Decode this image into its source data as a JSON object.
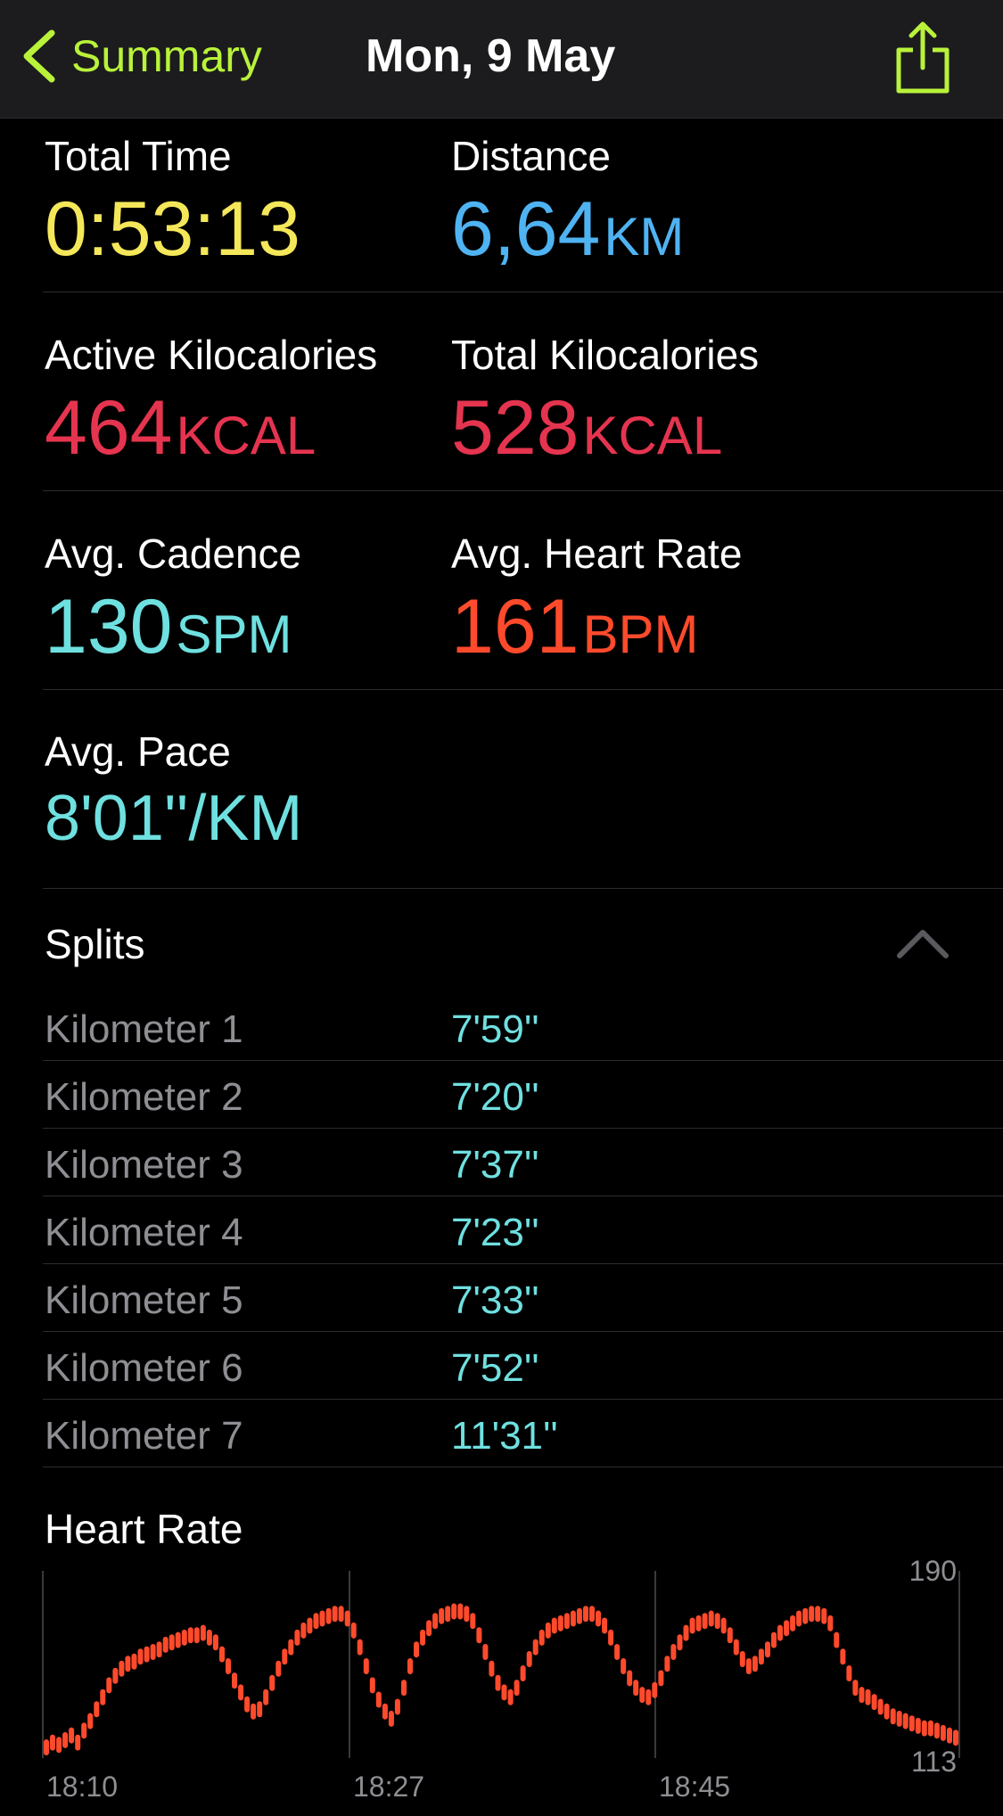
{
  "nav": {
    "back_label": "Summary",
    "title": "Mon, 9 May",
    "accent_color": "#b9f23a",
    "back_icon": "chevron-left-icon",
    "share_icon": "share-icon"
  },
  "stats": {
    "total_time": {
      "label": "Total Time",
      "value": "0:53:13",
      "unit": ""
    },
    "distance": {
      "label": "Distance",
      "value": "6,64",
      "unit": "KM"
    },
    "active_kcal": {
      "label": "Active Kilocalories",
      "value": "464",
      "unit": "KCAL"
    },
    "total_kcal": {
      "label": "Total Kilocalories",
      "value": "528",
      "unit": "KCAL"
    },
    "avg_cadence": {
      "label": "Avg. Cadence",
      "value": "130",
      "unit": "SPM"
    },
    "avg_hr": {
      "label": "Avg. Heart Rate",
      "value": "161",
      "unit": "BPM"
    },
    "avg_pace": {
      "label": "Avg. Pace",
      "value": "8'01''/KM",
      "unit": ""
    }
  },
  "colors": {
    "time": "#f4e75a",
    "distance": "#4fb3f2",
    "energy": "#e5344f",
    "cadence": "#6fe0e0",
    "heart": "#ff4a2c"
  },
  "splits": {
    "title": "Splits",
    "collapse_icon": "chevron-up-icon",
    "rows": [
      {
        "label": "Kilometer 1",
        "pace": "7'59''"
      },
      {
        "label": "Kilometer 2",
        "pace": "7'20''"
      },
      {
        "label": "Kilometer 3",
        "pace": "7'37''"
      },
      {
        "label": "Kilometer 4",
        "pace": "7'23''"
      },
      {
        "label": "Kilometer 5",
        "pace": "7'33''"
      },
      {
        "label": "Kilometer 6",
        "pace": "7'52''"
      },
      {
        "label": "Kilometer 7",
        "pace": "11'31''"
      }
    ]
  },
  "heart_rate": {
    "title": "Heart Rate",
    "y_max_label": "190",
    "y_min_label": "113",
    "x_labels": [
      "18:10",
      "18:27",
      "18:45"
    ]
  },
  "chart_data": {
    "type": "scatter",
    "title": "Heart Rate",
    "xlabel": "",
    "ylabel": "",
    "ylim": [
      113,
      190
    ],
    "x_tick_labels": [
      "18:10",
      "18:27",
      "18:45"
    ],
    "series": [
      {
        "values": [
          116,
          118,
          117,
          119,
          121,
          118,
          123,
          127,
          132,
          137,
          142,
          146,
          149,
          151,
          152,
          154,
          155,
          156,
          157,
          159,
          160,
          161,
          162,
          163,
          163,
          164,
          162,
          160,
          155,
          150,
          144,
          139,
          134,
          131,
          132,
          137,
          143,
          149,
          154,
          158,
          162,
          165,
          167,
          169,
          170,
          171,
          172,
          172,
          170,
          165,
          158,
          150,
          142,
          136,
          131,
          128,
          133,
          141,
          150,
          157,
          162,
          166,
          169,
          171,
          172,
          173,
          173,
          172,
          169,
          163,
          156,
          149,
          143,
          139,
          137,
          141,
          147,
          153,
          158,
          162,
          165,
          167,
          168,
          169,
          170,
          171,
          172,
          172,
          170,
          167,
          162,
          156,
          150,
          145,
          141,
          138,
          137,
          140,
          145,
          151,
          156,
          160,
          164,
          167,
          168,
          169,
          170,
          169,
          167,
          163,
          158,
          153,
          150,
          151,
          154,
          157,
          161,
          164,
          166,
          168,
          170,
          171,
          172,
          172,
          171,
          168,
          161,
          154,
          147,
          141,
          138,
          137,
          135,
          133,
          131,
          129,
          128,
          127,
          126,
          125,
          124,
          124,
          123,
          122,
          121,
          120
        ]
      }
    ]
  }
}
